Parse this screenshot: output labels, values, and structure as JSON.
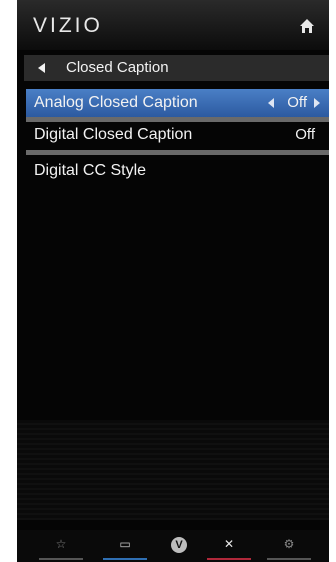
{
  "brand": {
    "logo_text": "VIZIO"
  },
  "header": {
    "home_icon": "home-icon"
  },
  "breadcrumb": {
    "back_icon": "back-arrow-icon",
    "title": "Closed Caption"
  },
  "menu": {
    "items": [
      {
        "label": "Analog Closed Caption",
        "value": "Off",
        "selected": true
      },
      {
        "label": "Digital Closed Caption",
        "value": "Off",
        "selected": false
      },
      {
        "label": "Digital CC Style",
        "value": "",
        "selected": false
      }
    ]
  },
  "footer": {
    "buttons": [
      {
        "icon": "star-icon",
        "glyph": "☆",
        "color": "#555555"
      },
      {
        "icon": "screen-icon",
        "glyph": "▭",
        "color": "#2f6fb3"
      },
      {
        "icon": "v-icon",
        "glyph": "V",
        "color": "#777777"
      },
      {
        "icon": "close-icon",
        "glyph": "✕",
        "color": "#b0283a"
      },
      {
        "icon": "gear-icon",
        "glyph": "⚙",
        "color": "#555555"
      }
    ]
  },
  "colors": {
    "selected_row": "#3b6fb8",
    "background": "#050505",
    "text": "#f2f2f2"
  }
}
